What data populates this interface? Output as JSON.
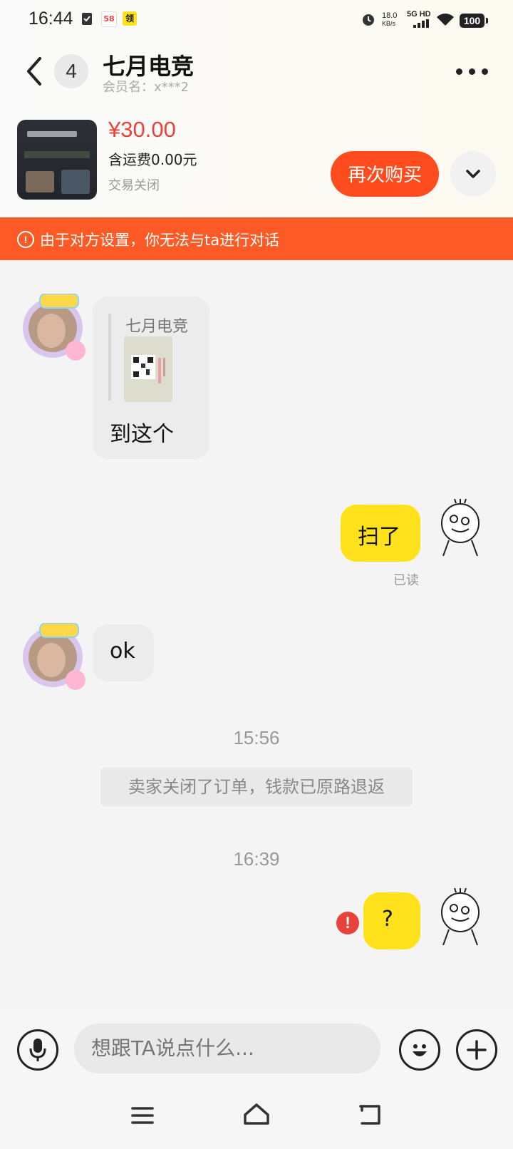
{
  "status_bar": {
    "time": "16:44",
    "app_badge_58": "58",
    "app_badge_other": "领",
    "net_speed": "18.0",
    "net_unit": "KB/s",
    "network": "5G HD",
    "battery": "100"
  },
  "header": {
    "back_icon": "chevron-left-icon",
    "unread_count": "4",
    "shop_name": "七月电竞",
    "member_label": "会员名：x***2",
    "more_icon": "more-dots-icon"
  },
  "product": {
    "price": "¥30.00",
    "shipping": "含运费0.00元",
    "status": "交易关闭",
    "rebuy_label": "再次购买",
    "expand_icon": "chevron-down-icon"
  },
  "notice": {
    "icon": "warning-circle-icon",
    "text": "由于对方设置，你无法与ta进行对话"
  },
  "messages": [
    {
      "from": "seller",
      "quote_name": "七月电竞",
      "text": "到这个"
    },
    {
      "from": "me",
      "text": "扫了",
      "status": "已读"
    },
    {
      "from": "seller",
      "text": "ok"
    },
    {
      "type": "time",
      "text": "15:56"
    },
    {
      "type": "system",
      "text": "卖家关闭了订单，钱款已原路退返"
    },
    {
      "type": "time",
      "text": "16:39"
    },
    {
      "from": "me",
      "text": "?",
      "failed_icon": "!"
    }
  ],
  "input_bar": {
    "voice_icon": "microphone-icon",
    "placeholder": "想跟TA说点什么...",
    "emoji_icon": "emoji-icon",
    "plus_icon": "plus-icon"
  },
  "nav_bar": {
    "menu_icon": "menu-icon",
    "home_icon": "home-icon",
    "back_icon": "return-icon"
  },
  "colors": {
    "accent_orange": "#ff4c1f",
    "notice_bg": "#fe5a25",
    "price_red": "#e8423a",
    "my_bubble": "#ffe21b",
    "their_bubble": "#ececec"
  }
}
